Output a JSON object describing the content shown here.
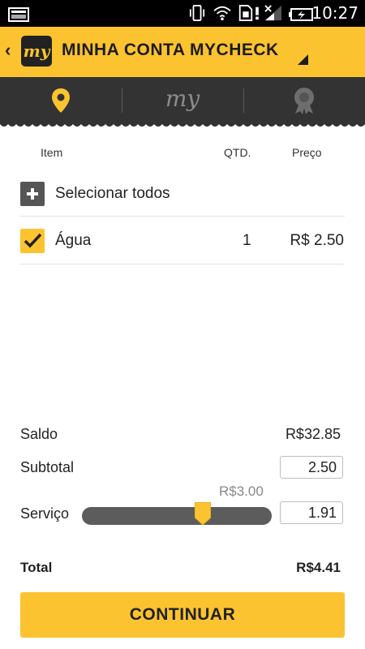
{
  "status_bar": {
    "time": "10:27"
  },
  "app_bar": {
    "back_glyph": "‹",
    "title": "MINHA CONTA MYCHECK",
    "logo_text": "my"
  },
  "tabs": [
    {
      "name": "location",
      "icon": "location-pin-icon",
      "active": true
    },
    {
      "name": "my",
      "icon": "my-logo-icon",
      "label": "my"
    },
    {
      "name": "rewards",
      "icon": "badge-award-icon"
    }
  ],
  "table": {
    "headers": {
      "item": "Item",
      "qty": "QTD.",
      "price": "Preço"
    },
    "select_all": "Selecionar todos",
    "items": [
      {
        "name": "Água",
        "qty": "1",
        "price": "R$ 2.50",
        "checked": true
      }
    ]
  },
  "summary": {
    "saldo_label": "Saldo",
    "saldo_value": "R$32.85",
    "subtotal_label": "Subtotal",
    "subtotal_value": "2.50",
    "servico_label": "Serviço",
    "servico_value": "1.91",
    "tip_tooltip": "R$3.00",
    "total_label": "Total",
    "total_value": "R$4.41"
  },
  "continue_button": "CONTINUAR",
  "colors": {
    "accent": "#fcc330",
    "dark": "#333333"
  }
}
